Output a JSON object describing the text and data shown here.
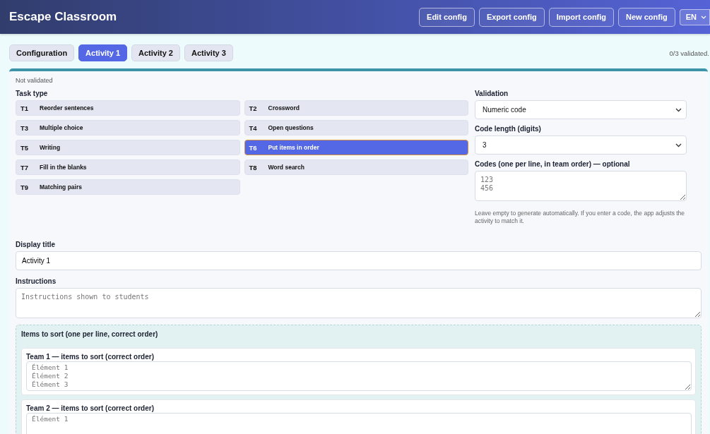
{
  "header": {
    "title": "Escape Classroom",
    "buttons": [
      "Edit config",
      "Export config",
      "Import config",
      "New config"
    ],
    "language": "EN"
  },
  "tabs": [
    {
      "label": "Configuration",
      "selected": false
    },
    {
      "label": "Activity 1",
      "selected": true
    },
    {
      "label": "Activity 2",
      "selected": false
    },
    {
      "label": "Activity 3",
      "selected": false
    }
  ],
  "progress": "0/3 validated.",
  "activity": {
    "status": "Not validated",
    "task_type_label": "Task type",
    "task_types": [
      {
        "code": "T1",
        "label": "Reorder sentences",
        "selected": false
      },
      {
        "code": "T2",
        "label": "Crossword",
        "selected": false
      },
      {
        "code": "T3",
        "label": "Multiple choice",
        "selected": false
      },
      {
        "code": "T4",
        "label": "Open questions",
        "selected": false
      },
      {
        "code": "T5",
        "label": "Writing",
        "selected": false
      },
      {
        "code": "T6",
        "label": "Put items in order",
        "selected": true
      },
      {
        "code": "T7",
        "label": "Fill in the blanks",
        "selected": false
      },
      {
        "code": "T8",
        "label": "Word search",
        "selected": false
      },
      {
        "code": "T9",
        "label": "Matching pairs",
        "selected": false
      }
    ],
    "validation": {
      "label": "Validation",
      "value": "Numeric code"
    },
    "code_length": {
      "label": "Code length (digits)",
      "value": "3"
    },
    "codes": {
      "label": "Codes (one per line, in team order) — optional",
      "placeholder": "123\n456"
    },
    "codes_hint": "Leave empty to generate automatically. If you enter a code, the app adjusts the activity to match it.",
    "display_title": {
      "label": "Display title",
      "value": "Activity 1"
    },
    "instructions": {
      "label": "Instructions",
      "placeholder": "Instructions shown to students"
    },
    "items_section": {
      "title": "Items to sort (one per line, correct order)",
      "teams": [
        {
          "label": "Team 1 — items to sort (correct order)",
          "placeholder": "Élément 1\nÉlément 2\nÉlément 3"
        },
        {
          "label": "Team 2 — items to sort (correct order)",
          "placeholder": "Élément 1"
        }
      ]
    }
  }
}
